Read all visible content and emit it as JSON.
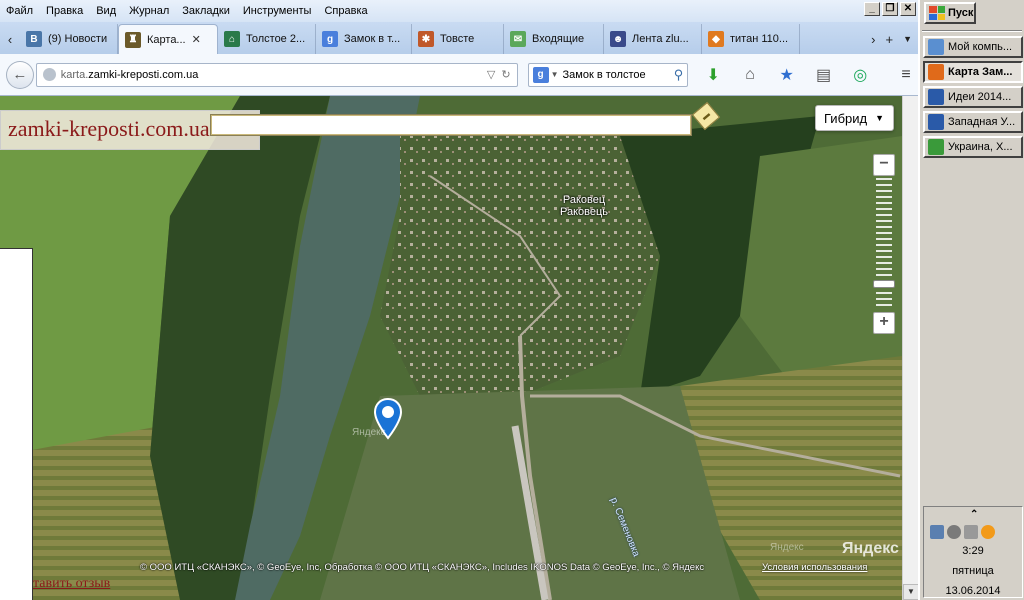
{
  "menu": [
    "Файл",
    "Правка",
    "Вид",
    "Журнал",
    "Закладки",
    "Инструменты",
    "Справка"
  ],
  "window_buttons": [
    "_",
    "❐",
    "✕"
  ],
  "tabs": [
    {
      "label": "(9) Новости",
      "icon": "vk-icon",
      "color": "#4a76a8",
      "glyph": "В",
      "active": false
    },
    {
      "label": "Карта...",
      "icon": "castle-icon",
      "color": "#6b5a2a",
      "glyph": "♜",
      "active": true
    },
    {
      "label": "Толстое 2...",
      "icon": "building-icon",
      "color": "#2a7a4a",
      "glyph": "⌂",
      "active": false
    },
    {
      "label": "Замок в т...",
      "icon": "google-icon",
      "color": "#4a7fdc",
      "glyph": "g",
      "active": false
    },
    {
      "label": "Товсте",
      "icon": "ornament-icon",
      "color": "#c0582a",
      "glyph": "✱",
      "active": false
    },
    {
      "label": "Входящие",
      "icon": "mail-icon",
      "color": "#5ba85b",
      "glyph": "✉",
      "active": false
    },
    {
      "label": "Лента zlu...",
      "icon": "user-icon",
      "color": "#3a4a8a",
      "glyph": "☻",
      "active": false
    },
    {
      "label": "титан 110...",
      "icon": "windows-icon",
      "color": "#e07a20",
      "glyph": "◆",
      "active": false
    }
  ],
  "url": {
    "prefix": "karta.",
    "domain": "zamki-kreposti.com.ua",
    "suffix": ""
  },
  "search": {
    "engine": "g",
    "value": "Замок в толстое"
  },
  "map": {
    "site_logo": "zamki-kreposti.com.ua",
    "layer_button": "Гибрид",
    "place_label_line1": "Раковец",
    "place_label_line2": "Раковець",
    "river_label": "р. Семеновка",
    "pin_watermark": "Яндекс",
    "copyright": "© ООО ИТЦ «СКАНЭКС», © GeoEye, Inc, Обработка © ООО ИТЦ «СКАНЭКС», Includes IKONOS Data © GeoEye, Inc., © Яндекс",
    "terms_link": "Условия использования",
    "yandex_logo": "Яндекс",
    "yandex_mark": "Яндекс",
    "review_link": "тавить отзыв",
    "ruler_icon": "ruler-icon"
  },
  "taskbar": {
    "start_label": "Пуск",
    "items": [
      {
        "label": "Мой компь...",
        "color": "#5a8fd0",
        "active": false
      },
      {
        "label": "Карта Зам...",
        "color": "#e06a1a",
        "active": true
      },
      {
        "label": "Идеи 2014...",
        "color": "#2a5aa8",
        "active": false
      },
      {
        "label": "Западная У...",
        "color": "#2a5aa8",
        "active": false
      },
      {
        "label": "Украина, Х...",
        "color": "#3a9a3a",
        "active": false
      }
    ],
    "clock_time": "3:29",
    "clock_day": "пятница",
    "clock_date": "13.06.2014"
  }
}
